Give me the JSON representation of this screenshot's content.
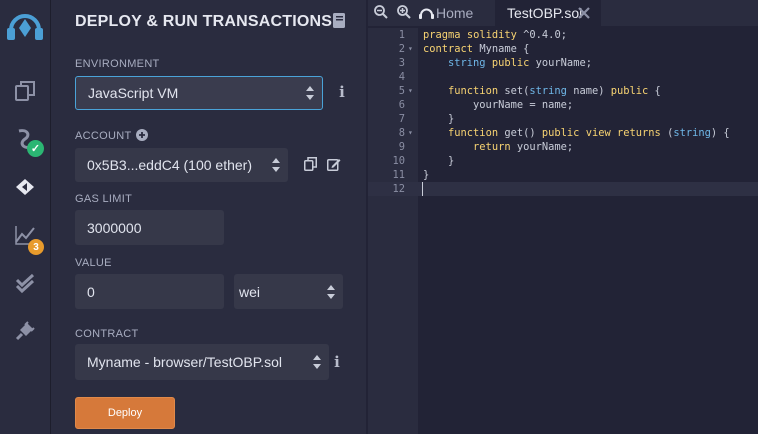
{
  "rail": {
    "badge_count": "3"
  },
  "panel": {
    "title": "DEPLOY & RUN TRANSACTIONS",
    "environment": {
      "label": "ENVIRONMENT",
      "value": "JavaScript VM"
    },
    "account": {
      "label": "ACCOUNT",
      "value": "0x5B3...eddC4 (100 ether)"
    },
    "gas_limit": {
      "label": "GAS LIMIT",
      "value": "3000000"
    },
    "value": {
      "label": "VALUE",
      "amount": "0",
      "unit": "wei"
    },
    "contract": {
      "label": "CONTRACT",
      "value": "Myname - browser/TestOBP.sol"
    },
    "deploy_label": "Deploy"
  },
  "editor": {
    "tabs": [
      {
        "label": "Home"
      },
      {
        "label": "TestOBP.sol"
      }
    ],
    "lines": [
      {
        "n": "1",
        "text": "pragma solidity ^0.4.0;"
      },
      {
        "n": "2",
        "text": "contract Myname {"
      },
      {
        "n": "3",
        "text": "    string public yourName;"
      },
      {
        "n": "4",
        "text": ""
      },
      {
        "n": "5",
        "text": "    function set(string name) public {"
      },
      {
        "n": "6",
        "text": "        yourName = name;"
      },
      {
        "n": "7",
        "text": "    }"
      },
      {
        "n": "8",
        "text": "    function get() public view returns (string) {"
      },
      {
        "n": "9",
        "text": "        return yourName;"
      },
      {
        "n": "10",
        "text": "    }"
      },
      {
        "n": "11",
        "text": "}"
      },
      {
        "n": "12",
        "text": ""
      }
    ]
  },
  "colors": {
    "accent": "#d6793a",
    "focus": "#4aa3d8",
    "keyword": "#f7d372",
    "type": "#6fb7e8",
    "success": "#2bb673",
    "badge": "#e89b2c"
  }
}
